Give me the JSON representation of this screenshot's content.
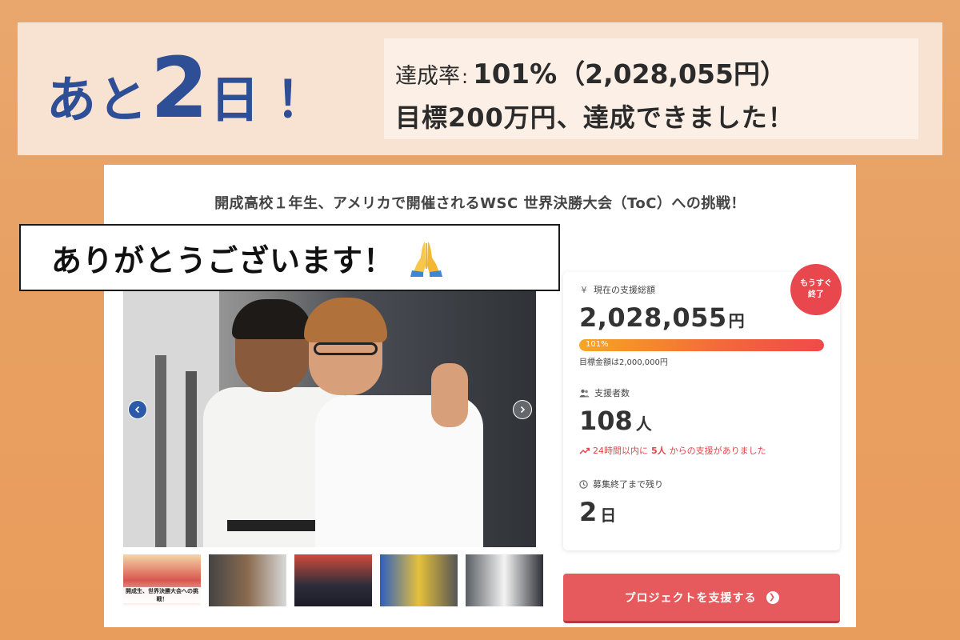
{
  "banner": {
    "countdown_pre": "あと",
    "countdown_num": "2",
    "countdown_post": "日",
    "countdown_bang": "！",
    "achieve_label": "達成率",
    "achieve_colon": ":",
    "achieve_rate": "101%",
    "achieve_amount": "（2,028,055円）",
    "achieve_message": "目標200万円、達成できました！"
  },
  "project": {
    "title": "開成高校１年生、アメリカで開催されるWSC 世界決勝大会（ToC）への挑戦！"
  },
  "overlay": {
    "thanks": "ありがとうございます！",
    "icon": "praying-hands-icon"
  },
  "gallery": {
    "thumb1_caption": "開成生、世界決勝大会への挑戦！"
  },
  "stats": {
    "total_label": "現在の支援総額",
    "total_value": "2,028,055",
    "total_unit": "円",
    "progress_text": "101%",
    "progress_fraction": 1.0,
    "goal_text": "目標金額は2,000,000円",
    "supporters_label": "支援者数",
    "supporters_value": "108",
    "supporters_unit": "人",
    "recent_pre": "24時間以内に",
    "recent_num": "5人",
    "recent_post": "からの支援がありました",
    "remaining_label": "募集終了まで残り",
    "remaining_value": "2",
    "remaining_unit": "日"
  },
  "badge": {
    "line1": "もうすぐ",
    "line2": "終了"
  },
  "cta": {
    "label": "プロジェクトを支援する",
    "arrow": "❯"
  },
  "colors": {
    "accent_blue": "#2e4f96",
    "cta_red": "#e65a5e",
    "badge_red": "#e8474d",
    "background_orange": "#e9a76e"
  }
}
